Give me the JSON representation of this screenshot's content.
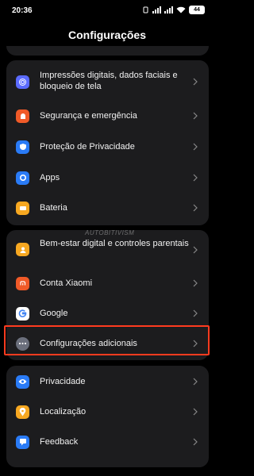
{
  "status_bar": {
    "time": "20:36",
    "battery": "44"
  },
  "header": {
    "title": "Configurações"
  },
  "sections": [
    {
      "items": [
        {
          "label": "Impressões digitais, dados faciais e bloqueio de tela",
          "icon": "fingerprint-icon",
          "color": "#5b6bff"
        },
        {
          "label": "Segurança e emergência",
          "icon": "alarm-icon",
          "color": "#f05a28"
        },
        {
          "label": "Proteção de Privacidade",
          "icon": "shield-icon",
          "color": "#2a7bf6"
        },
        {
          "label": "Apps",
          "icon": "gear-icon",
          "color": "#2a7bf6"
        },
        {
          "label": "Bateria",
          "icon": "battery-icon",
          "color": "#f7a821"
        }
      ]
    },
    {
      "items": [
        {
          "label": "Bem-estar digital e controles parentais",
          "icon": "person-icon",
          "color": "#f7a821"
        },
        {
          "label": "Conta Xiaomi",
          "icon": "xiaomi-logo-icon",
          "color": "#f05a28"
        },
        {
          "label": "Google",
          "icon": "google-logo-icon",
          "color": "#ffffff"
        },
        {
          "label": "Configurações adicionais",
          "icon": "more-dots-icon",
          "color": "#6b6f7c"
        }
      ]
    },
    {
      "items": [
        {
          "label": "Privacidade",
          "icon": "eye-icon",
          "color": "#2a7bf6"
        },
        {
          "label": "Localização",
          "icon": "location-pin-icon",
          "color": "#f7a821"
        },
        {
          "label": "Feedback",
          "icon": "feedback-icon",
          "color": "#2a7bf6"
        }
      ]
    }
  ]
}
